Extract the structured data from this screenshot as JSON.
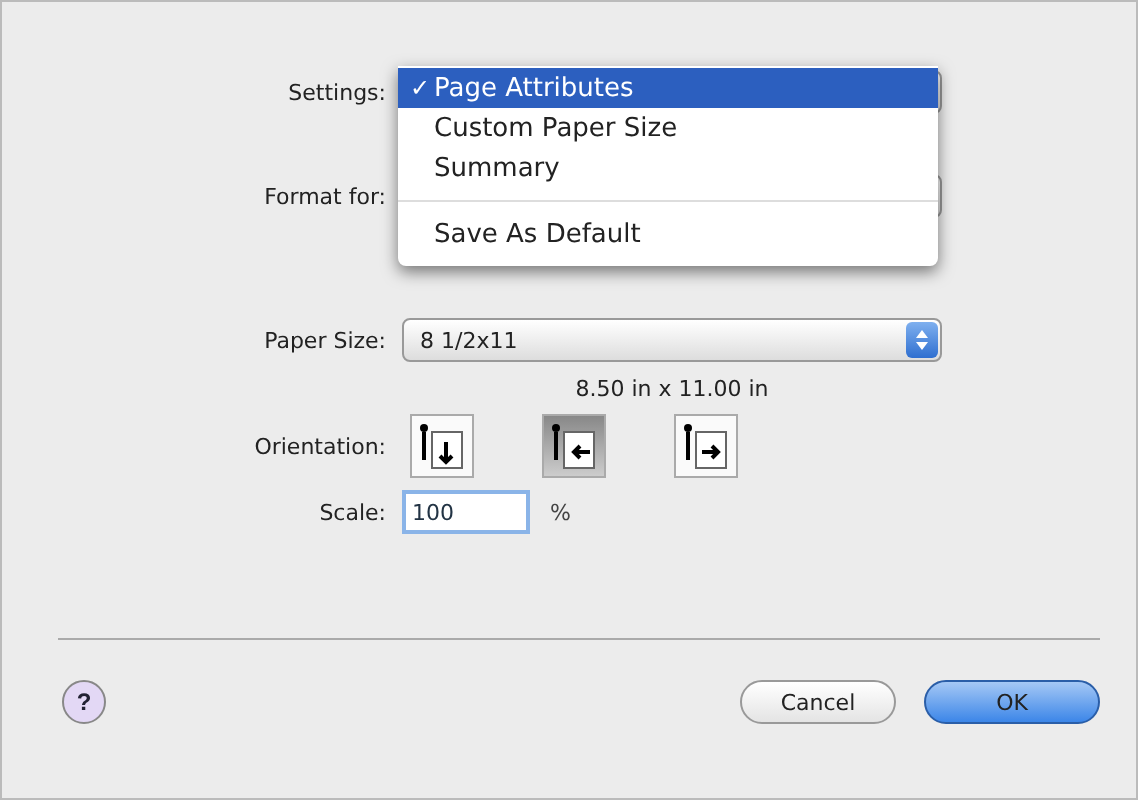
{
  "settings": {
    "label": "Settings:"
  },
  "settings_menu": [
    {
      "kind": "item",
      "label": "Page Attributes",
      "checked": true,
      "selected": true
    },
    {
      "kind": "item",
      "label": "Custom Paper Size",
      "checked": false,
      "selected": false
    },
    {
      "kind": "item",
      "label": "Summary",
      "checked": false,
      "selected": false
    },
    {
      "kind": "separator"
    },
    {
      "kind": "item",
      "label": "Save As Default",
      "checked": false,
      "selected": false
    }
  ],
  "check_mark": "✓",
  "format_for": {
    "label": "Format for:"
  },
  "paper_size": {
    "label": "Paper Size:",
    "value": "8 1/2x11",
    "dimensions": "8.50 in x 11.00 in"
  },
  "orientation": {
    "label": "Orientation:",
    "options": [
      {
        "kind": "portrait",
        "selected": false
      },
      {
        "kind": "landscape-left",
        "selected": true
      },
      {
        "kind": "landscape-right",
        "selected": false
      }
    ]
  },
  "scale": {
    "label": "Scale:",
    "value": "100",
    "unit": "%"
  },
  "help": "?",
  "buttons": [
    {
      "label": "Cancel",
      "default": false
    },
    {
      "label": "OK",
      "default": true
    }
  ]
}
